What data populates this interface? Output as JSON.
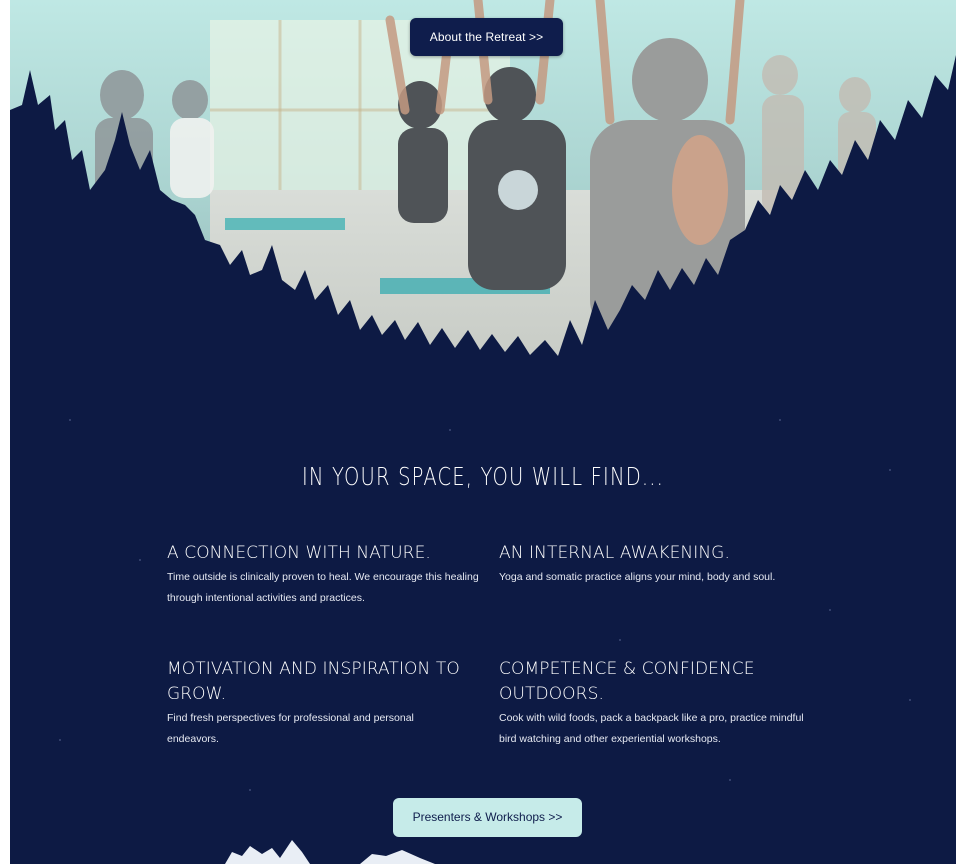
{
  "hero": {
    "about_button_label": "About the Retreat >>"
  },
  "section": {
    "heading": "IN YOUR SPACE, YOU WILL FIND..."
  },
  "features": [
    {
      "title": "A CONNECTION WITH NATURE.",
      "description": "Time outside is clinically proven to heal. We encourage this healing through intentional activities and practices."
    },
    {
      "title": "AN INTERNAL AWAKENING.",
      "description": "Yoga and somatic practice aligns your mind, body and soul."
    },
    {
      "title": "MOTIVATION AND INSPIRATION TO GROW.",
      "description": "Find fresh perspectives for professional and personal endeavors."
    },
    {
      "title": "COMPETENCE & CONFIDENCE OUTDOORS.",
      "description": "Cook with wild foods, pack a backpack like a pro, practice mindful bird watching and other experiential workshops."
    }
  ],
  "presenters_button_label": "Presenters & Workshops >>",
  "colors": {
    "navy": "#0d1a44",
    "mint": "#c6ebe9",
    "sky": "#bfe8e4"
  }
}
